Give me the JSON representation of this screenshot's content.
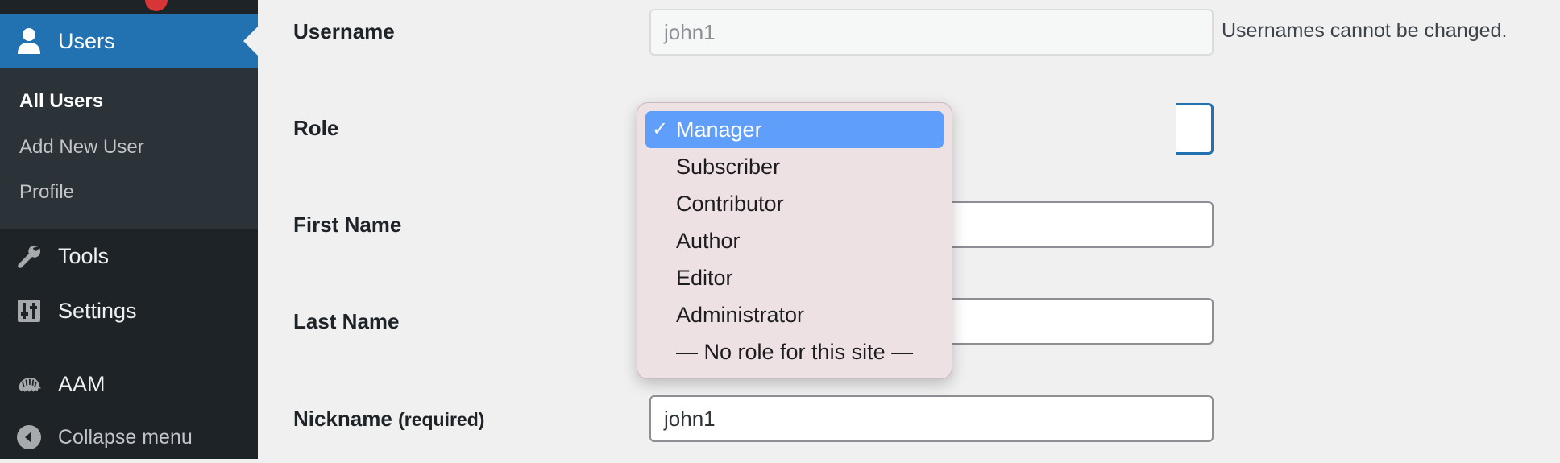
{
  "sidebar": {
    "users_label": "Users",
    "submenu": [
      "All Users",
      "Add New User",
      "Profile"
    ],
    "tools_label": "Tools",
    "settings_label": "Settings",
    "aam_label": "AAM",
    "collapse_label": "Collapse menu"
  },
  "form": {
    "username": {
      "label": "Username",
      "value": "john1",
      "description": "Usernames cannot be changed."
    },
    "role": {
      "label": "Role",
      "selected": "Manager",
      "check_mark": "✓",
      "options": [
        "Manager",
        "Subscriber",
        "Contributor",
        "Author",
        "Editor",
        "Administrator",
        "— No role for this site —"
      ]
    },
    "first_name": {
      "label": "First Name",
      "value": ""
    },
    "last_name": {
      "label": "Last Name",
      "value": ""
    },
    "nickname": {
      "label": "Nickname",
      "label_suffix": "(required)",
      "value": "john1"
    }
  },
  "colors": {
    "sidebar_bg": "#1d2327",
    "submenu_bg": "#2c3338",
    "accent": "#2271b1",
    "dropdown_bg": "#ede1e4",
    "selected_option": "#5f9efb"
  }
}
